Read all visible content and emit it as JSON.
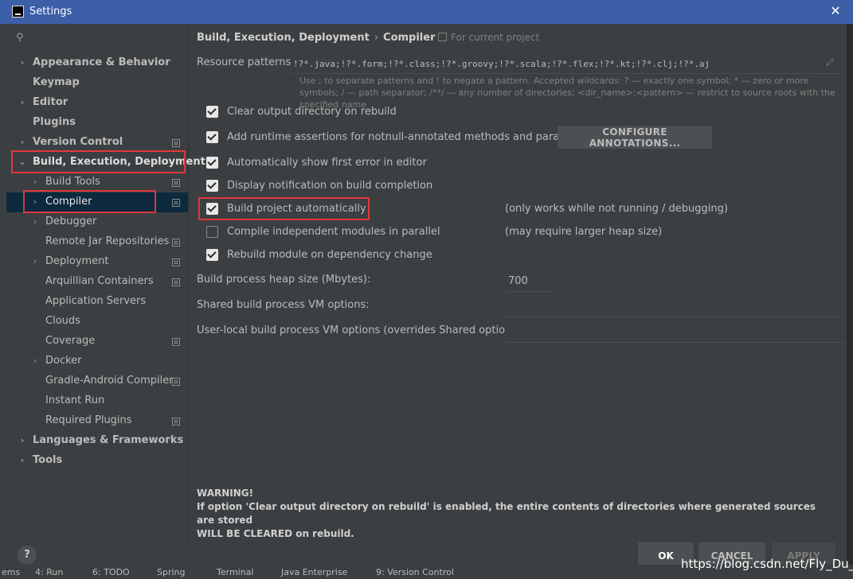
{
  "window": {
    "title": "Settings"
  },
  "search": {
    "placeholder": ""
  },
  "sidebar": {
    "items": [
      {
        "label": "Appearance & Behavior"
      },
      {
        "label": "Keymap"
      },
      {
        "label": "Editor"
      },
      {
        "label": "Plugins"
      },
      {
        "label": "Version Control"
      },
      {
        "label": "Build, Execution, Deployment"
      },
      {
        "label": "Build Tools"
      },
      {
        "label": "Compiler"
      },
      {
        "label": "Debugger"
      },
      {
        "label": "Remote Jar Repositories"
      },
      {
        "label": "Deployment"
      },
      {
        "label": "Arquillian Containers"
      },
      {
        "label": "Application Servers"
      },
      {
        "label": "Clouds"
      },
      {
        "label": "Coverage"
      },
      {
        "label": "Docker"
      },
      {
        "label": "Gradle-Android Compiler"
      },
      {
        "label": "Instant Run"
      },
      {
        "label": "Required Plugins"
      },
      {
        "label": "Languages & Frameworks"
      },
      {
        "label": "Tools"
      }
    ]
  },
  "breadcrumb": {
    "parent": "Build, Execution, Deployment",
    "sep": "›",
    "current": "Compiler",
    "scope": "For current project"
  },
  "resource": {
    "label": "Resource patterns:",
    "value": "!?*.java;!?*.form;!?*.class;!?*.groovy;!?*.scala;!?*.flex;!?*.kt;!?*.clj;!?*.aj",
    "help": "Use ; to separate patterns and ! to negate a pattern. Accepted wildcards: ? — exactly one symbol; * — zero or more symbols; / — path separator; /**/ — any number of directories; <dir_name>:<pattern> — restrict to source roots with the specified name"
  },
  "options": [
    {
      "label": "Clear output directory on rebuild",
      "checked": true
    },
    {
      "label": "Add runtime assertions for notnull-annotated methods and parameters",
      "checked": true
    },
    {
      "label": "Automatically show first error in editor",
      "checked": true
    },
    {
      "label": "Display notification on build completion",
      "checked": true
    },
    {
      "label": "Build project automatically",
      "checked": true,
      "hint": "(only works while not running / debugging)"
    },
    {
      "label": "Compile independent modules in parallel",
      "checked": false,
      "hint": "(may require larger heap size)"
    },
    {
      "label": "Rebuild module on dependency change",
      "checked": true
    }
  ],
  "configure_button": "CONFIGURE ANNOTATIONS...",
  "heap": {
    "label": "Build process heap size (Mbytes):",
    "value": "700"
  },
  "shared_vm": {
    "label": "Shared build process VM options:",
    "value": ""
  },
  "local_vm": {
    "label": "User-local build process VM options (overrides Shared options):",
    "value": ""
  },
  "warning": {
    "title": "WARNING!",
    "line1": "If option 'Clear output directory on rebuild' is enabled, the entire contents of directories where generated sources are stored",
    "line2": "WILL BE CLEARED on rebuild."
  },
  "buttons": {
    "help": "?",
    "ok": "OK",
    "cancel": "CANCEL",
    "apply": "APPLY"
  },
  "taskbar": [
    "ems",
    "4: Run",
    "6: TODO",
    "Spring",
    "Terminal",
    "Java Enterprise",
    "9: Version Control"
  ],
  "watermark": "https://blog.csdn.net/Fly_Du_"
}
